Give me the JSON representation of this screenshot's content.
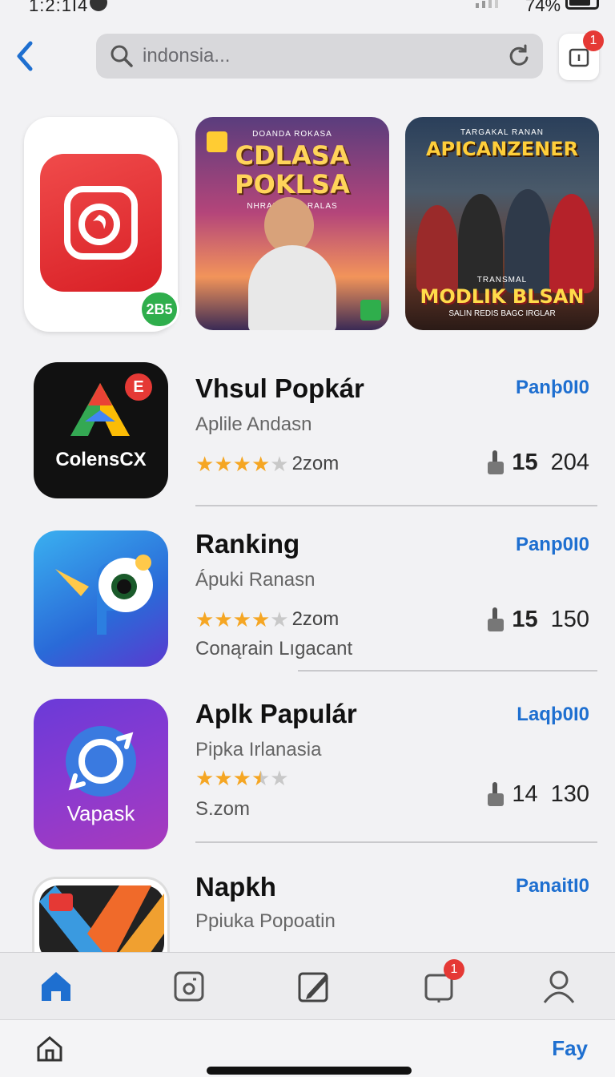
{
  "status": {
    "time": "1:2:1I4",
    "battery": "74%"
  },
  "search": {
    "query": "indonsia...",
    "badge": "1"
  },
  "featured": {
    "app_badge": "2B5",
    "poster1": {
      "title": "CDLASA POKLSA",
      "top_text": "DOANDA ROKASA",
      "sub": "NHRANANDA RALAS"
    },
    "poster2": {
      "top_text": "TARGAKAL RANAN",
      "title": "APICANZENER",
      "bottom_title": "MODLIK BLSAN",
      "bottom_top": "TRANSMAL",
      "bottom_sub": "SALIN REDIS BAGC IRGLAR"
    }
  },
  "apps": [
    {
      "name": "Vhsul Popkár",
      "sub": "Aplile Andasn",
      "action": "Panþ0I0",
      "rating": 4,
      "rating_label": "2zom",
      "extra": "",
      "stat_num": "15",
      "stat_val": "204",
      "icon_label": "ColensCX",
      "icon_badge": "E"
    },
    {
      "name": "Ranking",
      "sub": "Ápuki Ranasn",
      "action": "Panp0I0",
      "rating": 4,
      "rating_label": "2zom",
      "extra": "Conąrain Lıgacant",
      "stat_num": "15",
      "stat_val": "150",
      "icon_label": "",
      "icon_badge": ""
    },
    {
      "name": "Aplk Papulár",
      "sub": "Pipka Irlanasia",
      "action": "Laqþ0I0",
      "rating": 3.5,
      "rating_label": "",
      "extra": "S.zom",
      "stat_num": "14",
      "stat_val": "130",
      "icon_label": "Vapask",
      "icon_badge": ""
    },
    {
      "name": "Napkh",
      "sub": "Ppiuka Popoatin",
      "action": "PanaitI0",
      "rating": 0,
      "rating_label": "",
      "extra": "",
      "stat_num": "",
      "stat_val": "",
      "icon_label": "",
      "icon_badge": ""
    }
  ],
  "tabs": {
    "badge": "1"
  },
  "bottom": {
    "link": "Fay"
  },
  "colors": {
    "accent": "#1e6fd0",
    "star": "#f5a623",
    "badge": "#e53935"
  }
}
